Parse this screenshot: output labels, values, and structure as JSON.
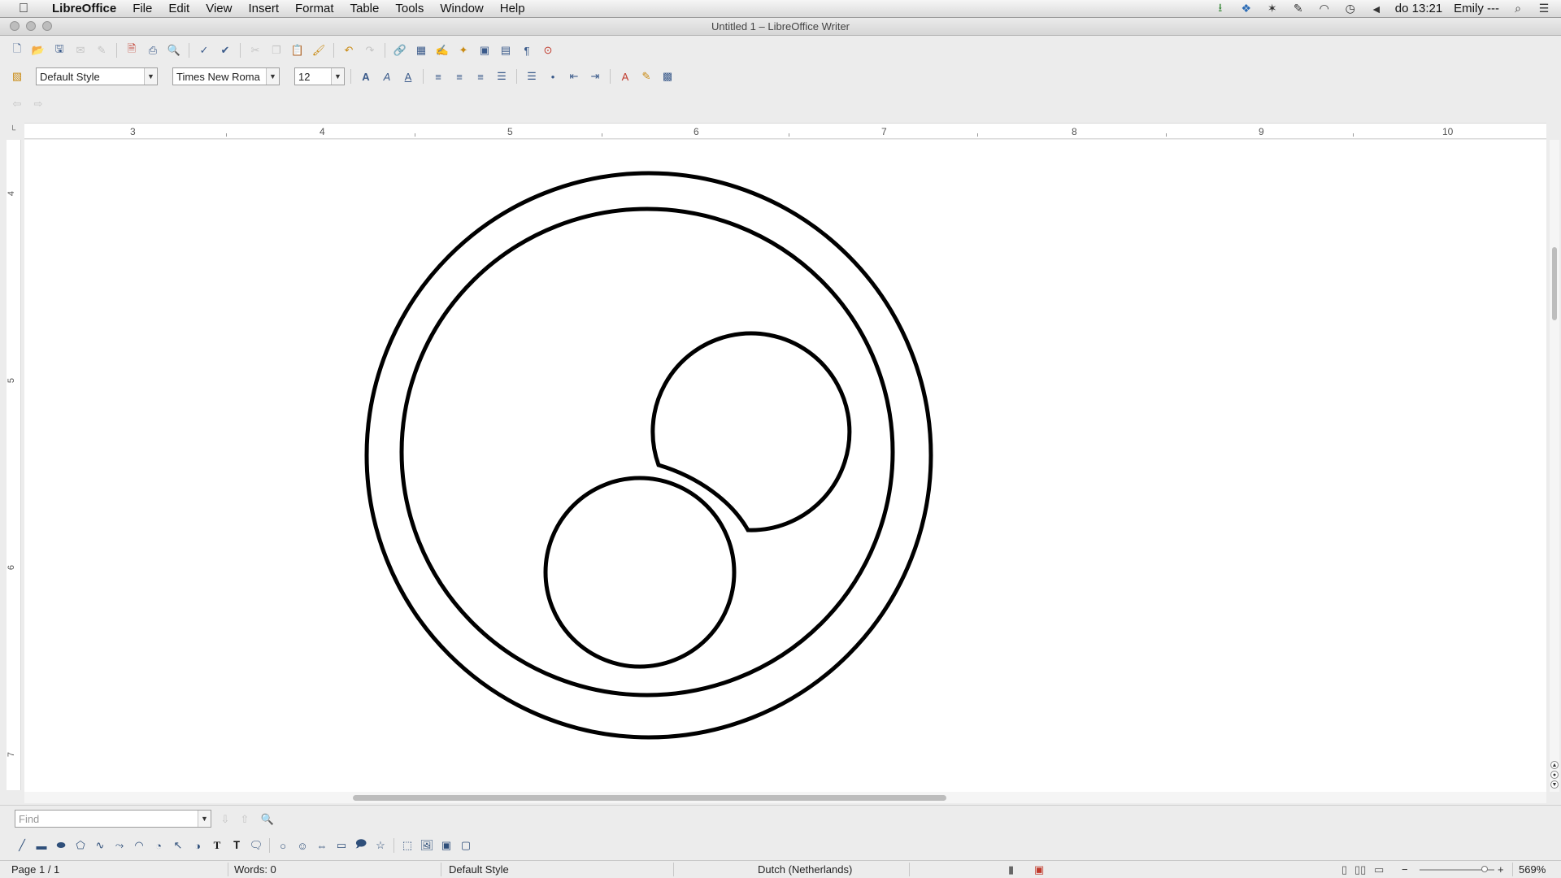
{
  "menubar": {
    "apple_icon": "apple-icon",
    "items": [
      "LibreOffice",
      "File",
      "Edit",
      "View",
      "Insert",
      "Format",
      "Table",
      "Tools",
      "Window",
      "Help"
    ],
    "clock": "do 13:21",
    "user": "Emily ‑‑‑"
  },
  "window": {
    "title": "Untitled 1 – LibreOffice Writer"
  },
  "format_toolbar": {
    "paragraph_style": "Default Style",
    "font_name": "Times New Roma",
    "font_size": "12"
  },
  "ruler": {
    "horizontal_labels": [
      "3",
      "4",
      "5",
      "6",
      "7",
      "8",
      "9",
      "10"
    ],
    "vertical_labels": [
      "4",
      "5",
      "6",
      "7"
    ]
  },
  "find_toolbar": {
    "placeholder": "Find"
  },
  "statusbar": {
    "page": "Page 1 / 1",
    "words": "Words: 0",
    "page_style": "Default Style",
    "language": "Dutch (Netherlands)",
    "zoom": "569%",
    "zoom_level": 0.9
  }
}
